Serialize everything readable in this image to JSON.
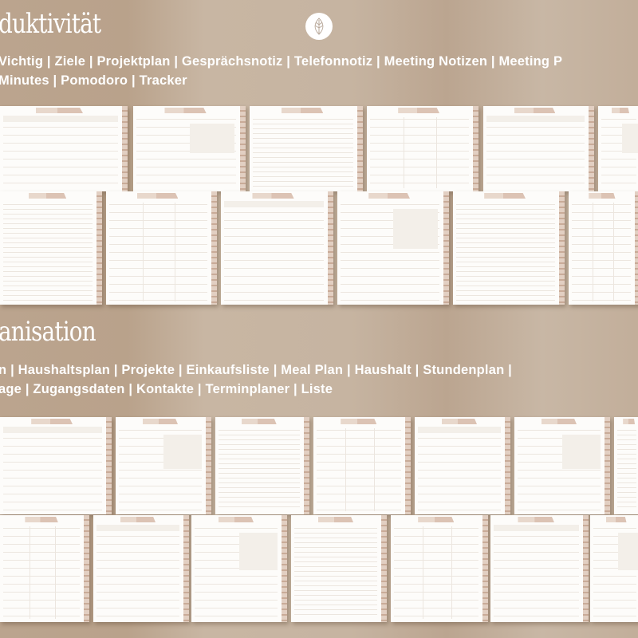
{
  "sections": [
    {
      "title": "duktivität",
      "line1": "Vichtig | Ziele | Projektplan | Gesprächsnotiz | Telefonnotiz | Meeting Notizen | Meeting P",
      "line2": "Minutes | Pomodoro | Tracker"
    },
    {
      "title": "anisation",
      "line1": "n  |  Haushaltsplan  |  Projekte  |  Einkaufsliste  |  Meal  Plan  |  Haushalt  |  Stundenplan  |",
      "line2": "age | Zugangsdaten | Kontakte | Terminplaner | Liste"
    }
  ],
  "logo": {
    "icon": "leaf-icon"
  },
  "colors": {
    "background": "#c4b09c",
    "page": "#fdfcfa",
    "tab": "#dcc3b4",
    "text": "#ffffff"
  }
}
